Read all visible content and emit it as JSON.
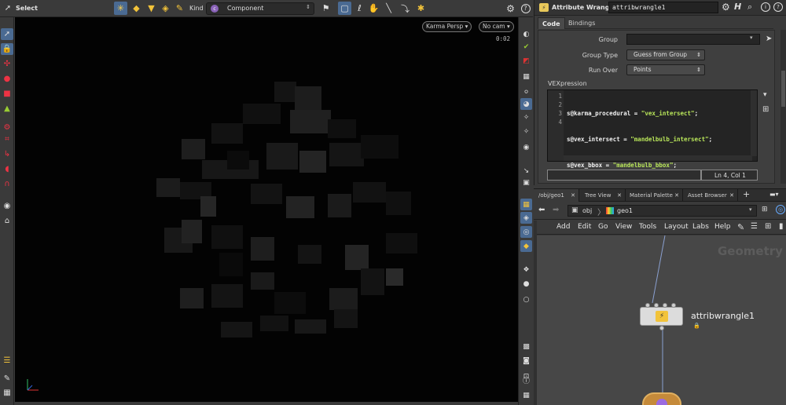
{
  "viewport_toolbar": {
    "mode_label": "Select",
    "kind_label": "Kind",
    "kind_value": "Component"
  },
  "viewport": {
    "camera_label": "Karma Persp",
    "nocam_label": "No cam",
    "timer": "0:02"
  },
  "param_pane": {
    "node_type": "Attribute Wrangle",
    "node_name": "attribwrangle1",
    "tabs": [
      "Code",
      "Bindings"
    ],
    "fields": {
      "group_label": "Group",
      "group_value": "",
      "group_type_label": "Group Type",
      "group_type_value": "Guess from Group",
      "run_over_label": "Run Over",
      "run_over_value": "Points"
    },
    "vex_label": "VEXpression",
    "code_lines": [
      {
        "num": "1",
        "var": "s@karma_procedural",
        "str": "\"vex_intersect\""
      },
      {
        "num": "2",
        "var": "s@vex_intersect",
        "str": "\"mandelbulb_intersect\""
      },
      {
        "num": "3",
        "var": "s@vex_bbox",
        "str": "\"mandelbulb_bbox\""
      },
      {
        "num": "4",
        "var": "",
        "str": ""
      }
    ],
    "cursor_status": "Ln 4, Col 1"
  },
  "network": {
    "tabs": [
      "/obj/geo1",
      "Tree View",
      "Material Palette",
      "Asset Browser"
    ],
    "add_tab": "+",
    "path": [
      "obj",
      "geo1"
    ],
    "menu": [
      "Add",
      "Edit",
      "Go",
      "View",
      "Tools",
      "Layout",
      "Labs",
      "Help"
    ],
    "watermark": "Geometry",
    "node_name": "attribwrangle1"
  },
  "colors": {
    "panel_bg": "#3a3a3a",
    "viewport_bg": "#030303",
    "network_bg": "#474747",
    "code_string": "#b9e65a",
    "accent_selected": "#4a6a92"
  }
}
